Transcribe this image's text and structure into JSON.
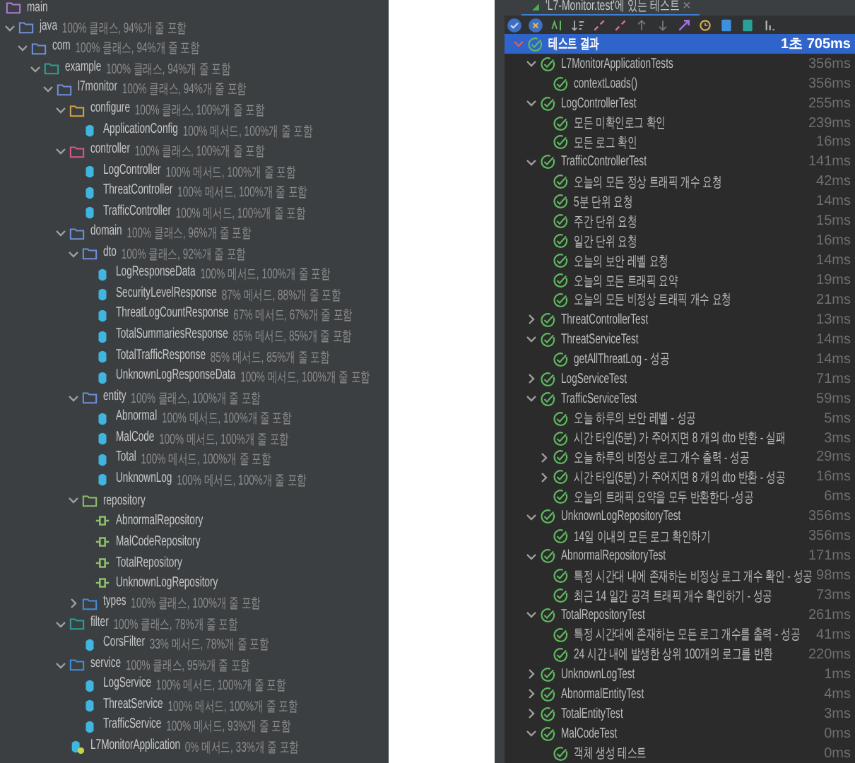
{
  "project_tree": [
    {
      "name": "main",
      "kind": "folder",
      "color": "#b07ad6",
      "children": [
        {
          "name": "java",
          "kind": "folder",
          "color": "#6f8fd8",
          "coverage": "100% 클래스, 94%개 줄 포함",
          "expanded": true,
          "children": [
            {
              "name": "com",
              "kind": "folder",
              "color": "#6f8fd8",
              "coverage": "100% 클래스, 94%개 줄 포함",
              "expanded": true,
              "children": [
                {
                  "name": "example",
                  "kind": "folder",
                  "color": "#2aa198",
                  "coverage": "100% 클래스, 94%개 줄 포함",
                  "expanded": true,
                  "children": [
                    {
                      "name": "l7monitor",
                      "kind": "folder",
                      "color": "#6f8fd8",
                      "coverage": "100% 클래스, 94%개 줄 포함",
                      "expanded": true,
                      "children": [
                        {
                          "name": "configure",
                          "kind": "folder",
                          "color": "#d9a343",
                          "coverage": "100% 클래스, 100%개 줄 포함",
                          "expanded": true,
                          "children": [
                            {
                              "name": "ApplicationConfig",
                              "kind": "class",
                              "coverage": "100% 메서드, 100%개 줄 포함"
                            }
                          ]
                        },
                        {
                          "name": "controller",
                          "kind": "folder",
                          "color": "#d65a8a",
                          "coverage": "100% 클래스, 100%개 줄 포함",
                          "expanded": true,
                          "children": [
                            {
                              "name": "LogController",
                              "kind": "class",
                              "coverage": "100% 메서드, 100%개 줄 포함"
                            },
                            {
                              "name": "ThreatController",
                              "kind": "class",
                              "coverage": "100% 메서드, 100%개 줄 포함"
                            },
                            {
                              "name": "TrafficController",
                              "kind": "class",
                              "coverage": "100% 메서드, 100%개 줄 포함"
                            }
                          ]
                        },
                        {
                          "name": "domain",
                          "kind": "folder",
                          "color": "#6f8fd8",
                          "coverage": "100% 클래스, 96%개 줄 포함",
                          "expanded": true,
                          "children": [
                            {
                              "name": "dto",
                              "kind": "folder",
                              "color": "#6f8fd8",
                              "coverage": "100% 클래스, 92%개 줄 포함",
                              "expanded": true,
                              "children": [
                                {
                                  "name": "LogResponseData",
                                  "kind": "class",
                                  "coverage": "100% 메서드, 100%개 줄 포함"
                                },
                                {
                                  "name": "SecurityLevelResponse",
                                  "kind": "class",
                                  "coverage": "87% 메서드, 88%개 줄 포함"
                                },
                                {
                                  "name": "ThreatLogCountResponse",
                                  "kind": "class",
                                  "coverage": "67% 메서드, 67%개 줄 포함"
                                },
                                {
                                  "name": "TotalSummariesResponse",
                                  "kind": "class",
                                  "coverage": "85% 메서드, 85%개 줄 포함"
                                },
                                {
                                  "name": "TotalTrafficResponse",
                                  "kind": "class",
                                  "coverage": "85% 메서드, 85%개 줄 포함"
                                },
                                {
                                  "name": "UnknownLogResponseData",
                                  "kind": "class",
                                  "coverage": "100% 메서드, 100%개 줄 포함"
                                }
                              ]
                            },
                            {
                              "name": "entity",
                              "kind": "folder",
                              "color": "#6f8fd8",
                              "coverage": "100% 클래스, 100%개 줄 포함",
                              "expanded": true,
                              "children": [
                                {
                                  "name": "Abnormal",
                                  "kind": "class",
                                  "coverage": "100% 메서드, 100%개 줄 포함"
                                },
                                {
                                  "name": "MalCode",
                                  "kind": "class",
                                  "coverage": "100% 메서드, 100%개 줄 포함"
                                },
                                {
                                  "name": "Total",
                                  "kind": "class",
                                  "coverage": "100% 메서드, 100%개 줄 포함"
                                },
                                {
                                  "name": "UnknownLog",
                                  "kind": "class",
                                  "coverage": "100% 메서드, 100%개 줄 포함"
                                }
                              ]
                            },
                            {
                              "name": "repository",
                              "kind": "folder",
                              "color": "#8fbf6a",
                              "expanded": true,
                              "children": [
                                {
                                  "name": "AbnormalRepository",
                                  "kind": "repository"
                                },
                                {
                                  "name": "MalCodeRepository",
                                  "kind": "repository"
                                },
                                {
                                  "name": "TotalRepository",
                                  "kind": "repository"
                                },
                                {
                                  "name": "UnknownLogRepository",
                                  "kind": "repository"
                                }
                              ]
                            },
                            {
                              "name": "types",
                              "kind": "folder",
                              "color": "#3f8fe0",
                              "coverage": "100% 클래스, 100%개 줄 포함",
                              "expanded": false
                            }
                          ]
                        },
                        {
                          "name": "filter",
                          "kind": "folder",
                          "color": "#2aa198",
                          "coverage": "100% 클래스, 78%개 줄 포함",
                          "expanded": true,
                          "children": [
                            {
                              "name": "CorsFilter",
                              "kind": "class",
                              "coverage": "33% 메서드, 78%개 줄 포함"
                            }
                          ]
                        },
                        {
                          "name": "service",
                          "kind": "folder",
                          "color": "#3f8fe0",
                          "coverage": "100% 클래스, 95%개 줄 포함",
                          "expanded": true,
                          "children": [
                            {
                              "name": "LogService",
                              "kind": "class",
                              "coverage": "100% 메서드, 100%개 줄 포함"
                            },
                            {
                              "name": "ThreatService",
                              "kind": "class",
                              "coverage": "100% 메서드, 100%개 줄 포함"
                            },
                            {
                              "name": "TrafficService",
                              "kind": "class",
                              "coverage": "100% 메서드, 93%개 줄 포함"
                            }
                          ]
                        },
                        {
                          "name": "L7MonitorApplication",
                          "kind": "app",
                          "coverage": "0% 메서드, 33%개 줄 포함"
                        }
                      ]
                    }
                  ]
                }
              ]
            }
          ]
        }
      ]
    }
  ],
  "test_results": {
    "tab_title": "'L7-Monitor.test'에 있는 테스트",
    "tab_close": "×",
    "tests": [
      {
        "name": "테스트 결과",
        "duration": "1초 705ms",
        "selected": true,
        "expanded": true,
        "children": [
          {
            "name": "L7MonitorApplicationTests",
            "duration": "356ms",
            "selected": false,
            "expanded": true,
            "children": [
              {
                "name": "contextLoads()",
                "duration": "356ms",
                "selected": false
              }
            ]
          },
          {
            "name": "LogControllerTest",
            "duration": "255ms",
            "selected": false,
            "expanded": true,
            "children": [
              {
                "name": "모든 미확인로그 확인",
                "duration": "239ms",
                "selected": false
              },
              {
                "name": "모든 로그 확인",
                "duration": "16ms",
                "selected": false
              }
            ]
          },
          {
            "name": "TrafficControllerTest",
            "duration": "141ms",
            "selected": false,
            "expanded": true,
            "children": [
              {
                "name": "오늘의 모든 정상 트래픽 개수 요청",
                "duration": "42ms",
                "selected": false
              },
              {
                "name": "5분 단위 요청",
                "duration": "14ms",
                "selected": false
              },
              {
                "name": "주간 단위 요청",
                "duration": "15ms",
                "selected": false
              },
              {
                "name": "일간 단위 요청",
                "duration": "16ms",
                "selected": false
              },
              {
                "name": "오늘의 보안 레벨 요청",
                "duration": "14ms",
                "selected": false
              },
              {
                "name": "오늘의 모든 트래픽 요약",
                "duration": "19ms",
                "selected": false
              },
              {
                "name": "오늘의 모든 비정상 트래픽 개수 요청",
                "duration": "21ms",
                "selected": false
              }
            ]
          },
          {
            "name": "ThreatControllerTest",
            "duration": "13ms",
            "selected": false,
            "expanded": false
          },
          {
            "name": "ThreatServiceTest",
            "duration": "14ms",
            "selected": false,
            "expanded": true,
            "children": [
              {
                "name": "getAllThreatLog - 성공",
                "duration": "14ms",
                "selected": false
              }
            ]
          },
          {
            "name": "LogServiceTest",
            "duration": "71ms",
            "selected": false,
            "expanded": false
          },
          {
            "name": "TrafficServiceTest",
            "duration": "59ms",
            "selected": false,
            "expanded": true,
            "children": [
              {
                "name": "오늘 하루의 보안 레벨 - 성공",
                "duration": "5ms",
                "selected": false
              },
              {
                "name": "시간 타입(5분) 가 주어지면 8 개의 dto 반환 - 실패",
                "duration": "3ms",
                "selected": false
              },
              {
                "name": "오늘 하루의 비정상 로그 개수 출력 - 성공",
                "duration": "29ms",
                "selected": false,
                "expanded": false
              },
              {
                "name": "시간 타입(5분) 가 주어지면 8 개의 dto 반환 - 성공",
                "duration": "16ms",
                "selected": false,
                "expanded": false
              },
              {
                "name": "오늘의 트래픽 요약을 모두 반환한다 -성공",
                "duration": "6ms",
                "selected": false
              }
            ]
          },
          {
            "name": "UnknownLogRepositoryTest",
            "duration": "356ms",
            "selected": false,
            "expanded": true,
            "children": [
              {
                "name": "14일 이내의 모든 로그 확인하기",
                "duration": "356ms",
                "selected": false
              }
            ]
          },
          {
            "name": "AbnormalRepositoryTest",
            "duration": "171ms",
            "selected": false,
            "expanded": true,
            "children": [
              {
                "name": "특정 시간대 내에 존재하는 비정상 로그 개수 확인 - 성공",
                "duration": "98ms",
                "selected": false
              },
              {
                "name": "최근 14 일간 공격 트래픽 개수 확인하기 - 성공",
                "duration": "73ms",
                "selected": false
              }
            ]
          },
          {
            "name": "TotalRepositoryTest",
            "duration": "261ms",
            "selected": false,
            "expanded": true,
            "children": [
              {
                "name": "특정 시간대에 존재하는 모든 로그 개수를 출력 - 성공",
                "duration": "41ms",
                "selected": false
              },
              {
                "name": "24 시간 내에 발생한 상위 100개의 로그를 반환",
                "duration": "220ms",
                "selected": false
              }
            ]
          },
          {
            "name": "UnknownLogTest",
            "duration": "1ms",
            "selected": false,
            "expanded": false
          },
          {
            "name": "AbnormalEntityTest",
            "duration": "4ms",
            "selected": false,
            "expanded": false
          },
          {
            "name": "TotalEntityTest",
            "duration": "3ms",
            "selected": false,
            "expanded": false
          },
          {
            "name": "MalCodeTest",
            "duration": "0ms",
            "selected": false,
            "expanded": true,
            "children": [
              {
                "name": "객체 생성 테스트",
                "duration": "0ms",
                "selected": false
              }
            ]
          }
        ]
      }
    ]
  }
}
